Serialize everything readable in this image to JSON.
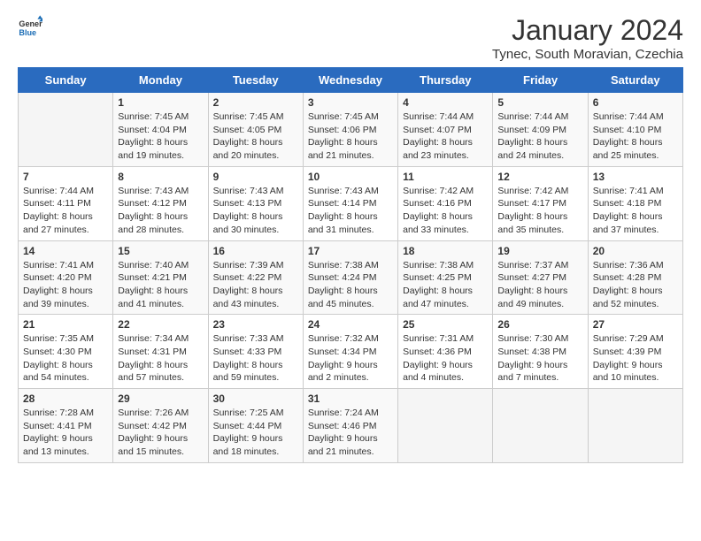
{
  "header": {
    "logo_line1": "General",
    "logo_line2": "Blue",
    "month": "January 2024",
    "location": "Tynec, South Moravian, Czechia"
  },
  "weekdays": [
    "Sunday",
    "Monday",
    "Tuesday",
    "Wednesday",
    "Thursday",
    "Friday",
    "Saturday"
  ],
  "weeks": [
    [
      {
        "day": "",
        "content": ""
      },
      {
        "day": "1",
        "content": "Sunrise: 7:45 AM\nSunset: 4:04 PM\nDaylight: 8 hours\nand 19 minutes."
      },
      {
        "day": "2",
        "content": "Sunrise: 7:45 AM\nSunset: 4:05 PM\nDaylight: 8 hours\nand 20 minutes."
      },
      {
        "day": "3",
        "content": "Sunrise: 7:45 AM\nSunset: 4:06 PM\nDaylight: 8 hours\nand 21 minutes."
      },
      {
        "day": "4",
        "content": "Sunrise: 7:44 AM\nSunset: 4:07 PM\nDaylight: 8 hours\nand 23 minutes."
      },
      {
        "day": "5",
        "content": "Sunrise: 7:44 AM\nSunset: 4:09 PM\nDaylight: 8 hours\nand 24 minutes."
      },
      {
        "day": "6",
        "content": "Sunrise: 7:44 AM\nSunset: 4:10 PM\nDaylight: 8 hours\nand 25 minutes."
      }
    ],
    [
      {
        "day": "7",
        "content": "Sunrise: 7:44 AM\nSunset: 4:11 PM\nDaylight: 8 hours\nand 27 minutes."
      },
      {
        "day": "8",
        "content": "Sunrise: 7:43 AM\nSunset: 4:12 PM\nDaylight: 8 hours\nand 28 minutes."
      },
      {
        "day": "9",
        "content": "Sunrise: 7:43 AM\nSunset: 4:13 PM\nDaylight: 8 hours\nand 30 minutes."
      },
      {
        "day": "10",
        "content": "Sunrise: 7:43 AM\nSunset: 4:14 PM\nDaylight: 8 hours\nand 31 minutes."
      },
      {
        "day": "11",
        "content": "Sunrise: 7:42 AM\nSunset: 4:16 PM\nDaylight: 8 hours\nand 33 minutes."
      },
      {
        "day": "12",
        "content": "Sunrise: 7:42 AM\nSunset: 4:17 PM\nDaylight: 8 hours\nand 35 minutes."
      },
      {
        "day": "13",
        "content": "Sunrise: 7:41 AM\nSunset: 4:18 PM\nDaylight: 8 hours\nand 37 minutes."
      }
    ],
    [
      {
        "day": "14",
        "content": "Sunrise: 7:41 AM\nSunset: 4:20 PM\nDaylight: 8 hours\nand 39 minutes."
      },
      {
        "day": "15",
        "content": "Sunrise: 7:40 AM\nSunset: 4:21 PM\nDaylight: 8 hours\nand 41 minutes."
      },
      {
        "day": "16",
        "content": "Sunrise: 7:39 AM\nSunset: 4:22 PM\nDaylight: 8 hours\nand 43 minutes."
      },
      {
        "day": "17",
        "content": "Sunrise: 7:38 AM\nSunset: 4:24 PM\nDaylight: 8 hours\nand 45 minutes."
      },
      {
        "day": "18",
        "content": "Sunrise: 7:38 AM\nSunset: 4:25 PM\nDaylight: 8 hours\nand 47 minutes."
      },
      {
        "day": "19",
        "content": "Sunrise: 7:37 AM\nSunset: 4:27 PM\nDaylight: 8 hours\nand 49 minutes."
      },
      {
        "day": "20",
        "content": "Sunrise: 7:36 AM\nSunset: 4:28 PM\nDaylight: 8 hours\nand 52 minutes."
      }
    ],
    [
      {
        "day": "21",
        "content": "Sunrise: 7:35 AM\nSunset: 4:30 PM\nDaylight: 8 hours\nand 54 minutes."
      },
      {
        "day": "22",
        "content": "Sunrise: 7:34 AM\nSunset: 4:31 PM\nDaylight: 8 hours\nand 57 minutes."
      },
      {
        "day": "23",
        "content": "Sunrise: 7:33 AM\nSunset: 4:33 PM\nDaylight: 8 hours\nand 59 minutes."
      },
      {
        "day": "24",
        "content": "Sunrise: 7:32 AM\nSunset: 4:34 PM\nDaylight: 9 hours\nand 2 minutes."
      },
      {
        "day": "25",
        "content": "Sunrise: 7:31 AM\nSunset: 4:36 PM\nDaylight: 9 hours\nand 4 minutes."
      },
      {
        "day": "26",
        "content": "Sunrise: 7:30 AM\nSunset: 4:38 PM\nDaylight: 9 hours\nand 7 minutes."
      },
      {
        "day": "27",
        "content": "Sunrise: 7:29 AM\nSunset: 4:39 PM\nDaylight: 9 hours\nand 10 minutes."
      }
    ],
    [
      {
        "day": "28",
        "content": "Sunrise: 7:28 AM\nSunset: 4:41 PM\nDaylight: 9 hours\nand 13 minutes."
      },
      {
        "day": "29",
        "content": "Sunrise: 7:26 AM\nSunset: 4:42 PM\nDaylight: 9 hours\nand 15 minutes."
      },
      {
        "day": "30",
        "content": "Sunrise: 7:25 AM\nSunset: 4:44 PM\nDaylight: 9 hours\nand 18 minutes."
      },
      {
        "day": "31",
        "content": "Sunrise: 7:24 AM\nSunset: 4:46 PM\nDaylight: 9 hours\nand 21 minutes."
      },
      {
        "day": "",
        "content": ""
      },
      {
        "day": "",
        "content": ""
      },
      {
        "day": "",
        "content": ""
      }
    ]
  ]
}
